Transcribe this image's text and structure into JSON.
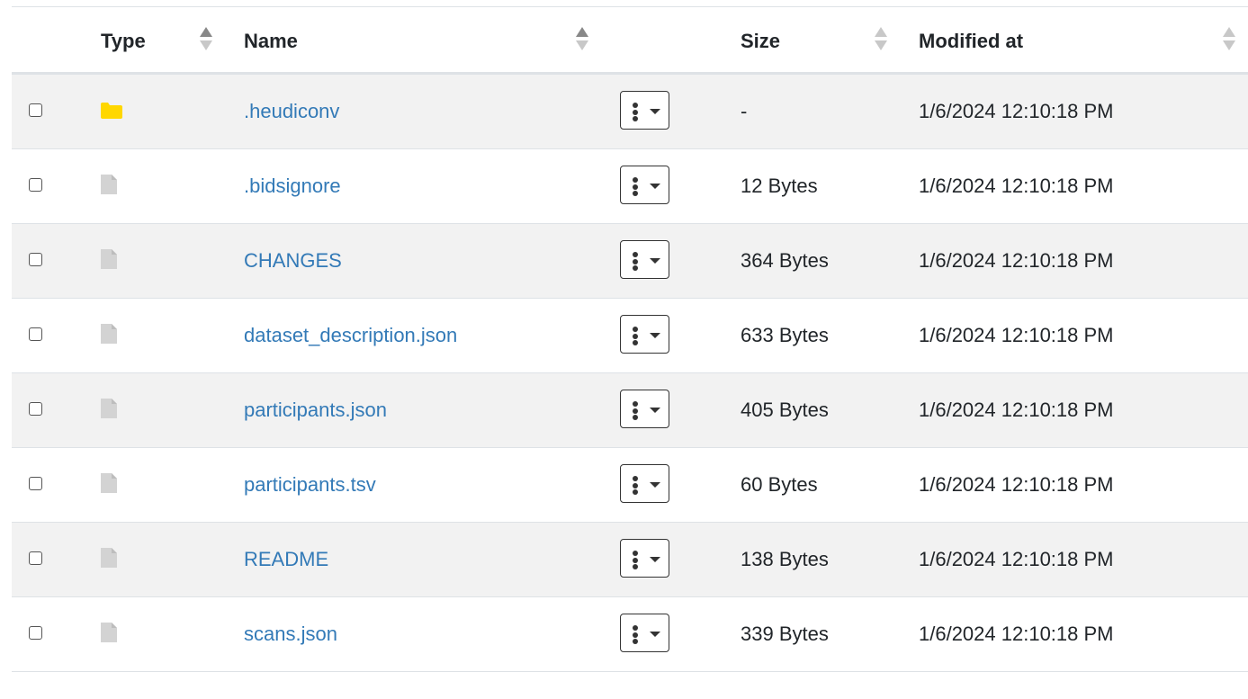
{
  "table": {
    "headers": {
      "type": "Type",
      "name": "Name",
      "size": "Size",
      "modified": "Modified at"
    },
    "rows": [
      {
        "type": "folder",
        "icon": "folder-icon",
        "name": ".heudiconv",
        "size": "-",
        "modified": "1/6/2024 12:10:18 PM"
      },
      {
        "type": "file",
        "icon": "file-icon",
        "name": ".bidsignore",
        "size": "12 Bytes",
        "modified": "1/6/2024 12:10:18 PM"
      },
      {
        "type": "file",
        "icon": "file-icon",
        "name": "CHANGES",
        "size": "364 Bytes",
        "modified": "1/6/2024 12:10:18 PM"
      },
      {
        "type": "file",
        "icon": "file-icon",
        "name": "dataset_description.json",
        "size": "633 Bytes",
        "modified": "1/6/2024 12:10:18 PM"
      },
      {
        "type": "file",
        "icon": "file-icon",
        "name": "participants.json",
        "size": "405 Bytes",
        "modified": "1/6/2024 12:10:18 PM"
      },
      {
        "type": "file",
        "icon": "file-icon",
        "name": "participants.tsv",
        "size": "60 Bytes",
        "modified": "1/6/2024 12:10:18 PM"
      },
      {
        "type": "file",
        "icon": "file-icon",
        "name": "README",
        "size": "138 Bytes",
        "modified": "1/6/2024 12:10:18 PM"
      },
      {
        "type": "file",
        "icon": "file-icon",
        "name": "scans.json",
        "size": "339 Bytes",
        "modified": "1/6/2024 12:10:18 PM"
      }
    ]
  },
  "colors": {
    "link": "#337ab7",
    "folder": "#ffd700",
    "file": "#d3d3d3",
    "stripe": "#f2f2f2"
  }
}
